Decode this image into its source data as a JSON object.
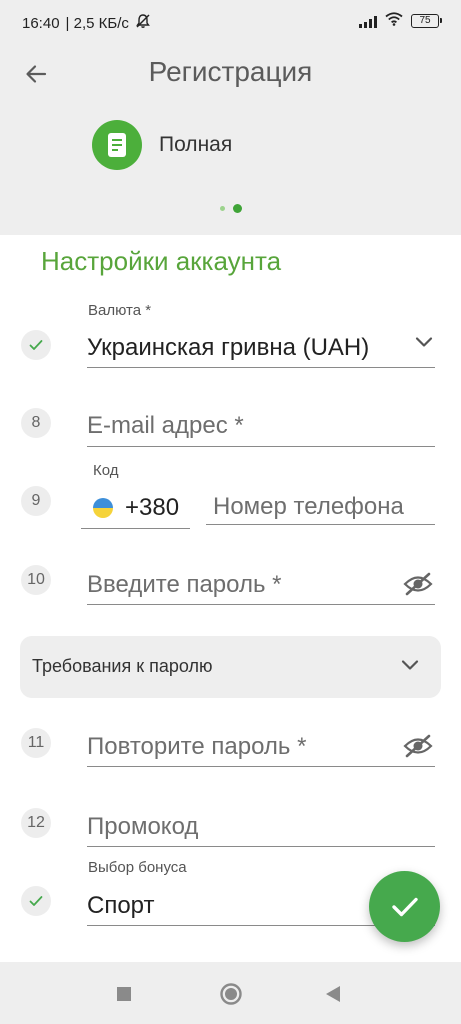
{
  "status_bar": {
    "time": "16:40",
    "network_speed": "| 2,5 КБ/с",
    "battery": "75",
    "icons": [
      "mute-icon",
      "signal-icon",
      "wifi-icon",
      "battery-icon"
    ]
  },
  "header": {
    "title": "Регистрация",
    "step_label": "Полная",
    "step_icon": "document-icon",
    "pager": {
      "total": 2,
      "active": 2
    }
  },
  "form": {
    "section_title": "Настройки аккаунта",
    "currency": {
      "label": "Валюта *",
      "value": "Украинская гривна (UAH)"
    },
    "email": {
      "number": "8",
      "placeholder": "E-mail адрес *"
    },
    "phone": {
      "number": "9",
      "code_label": "Код",
      "code_value": "+380",
      "placeholder": "Номер телефона"
    },
    "password": {
      "number": "10",
      "placeholder": "Введите пароль *"
    },
    "password_requirements": {
      "label": "Требования к паролю"
    },
    "password_repeat": {
      "number": "11",
      "placeholder": "Повторите пароль *"
    },
    "promocode": {
      "number": "12",
      "placeholder": "Промокод"
    },
    "bonus": {
      "label": "Выбор бонуса",
      "value": "Спорт"
    }
  },
  "colors": {
    "accent": "#4caf3b",
    "section_title": "#58a53b",
    "fab": "#46a94d",
    "header_bg": "#eeeeee"
  },
  "nav_bar": {
    "icons": [
      "recents-icon",
      "home-icon",
      "back-triangle-icon"
    ]
  }
}
